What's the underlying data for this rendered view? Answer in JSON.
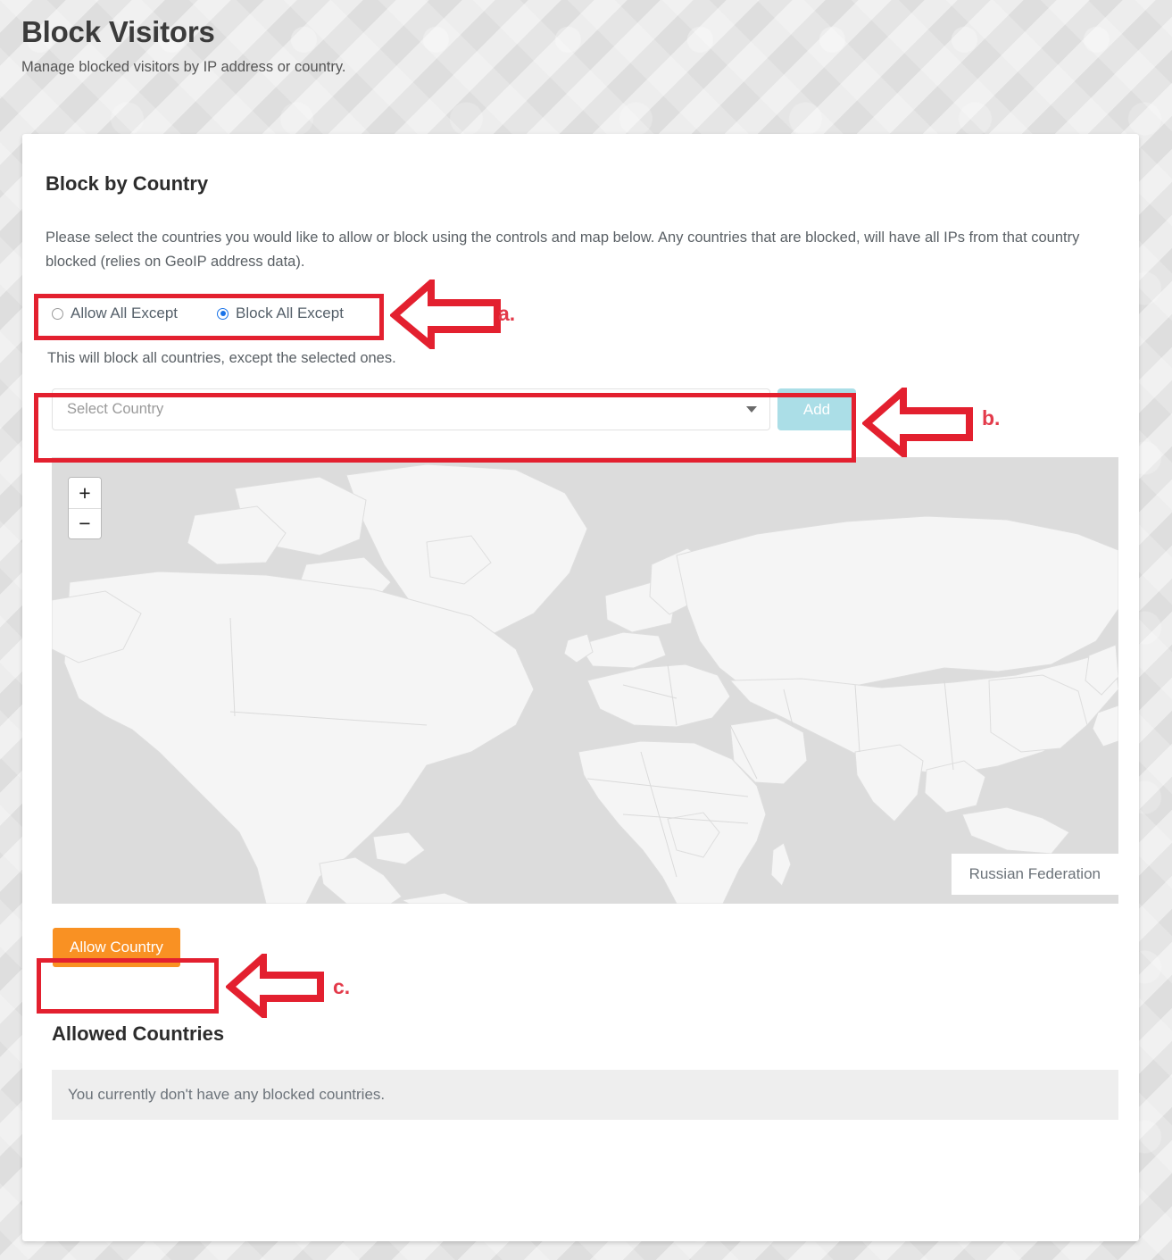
{
  "page": {
    "title": "Block Visitors",
    "subtitle": "Manage blocked visitors by IP address or country."
  },
  "card": {
    "title": "Block by Country",
    "description": "Please select the countries you would like to allow or block using the controls and map below. Any countries that are blocked, will have all IPs from that country blocked (relies on GeoIP address data).",
    "mode_hint": "This will block all countries, except the selected ones."
  },
  "mode_radios": {
    "allow_all_except": {
      "label": "Allow All Except",
      "selected": false
    },
    "block_all_except": {
      "label": "Block All Except",
      "selected": true
    }
  },
  "country_picker": {
    "placeholder": "Select Country",
    "value": "",
    "caret_icon": "chevron-down-icon",
    "add_label": "Add",
    "add_enabled": false
  },
  "map": {
    "zoom_in_label": "+",
    "zoom_out_label": "−",
    "tooltip_country": "Russian Federation",
    "ocean_color": "#dcdcdc",
    "land_color": "#f5f5f5",
    "border_color": "#dddddd"
  },
  "actions": {
    "allow_country_label": "Allow Country",
    "allow_country_color": "#f99123"
  },
  "allowed_countries": {
    "heading": "Allowed Countries",
    "empty_message": "You currently don't have any blocked countries.",
    "items": []
  },
  "annotations": {
    "color": "#e3202f",
    "markers": [
      {
        "id": "a",
        "label": "a.",
        "target": "mode-radio-group"
      },
      {
        "id": "b",
        "label": "b.",
        "target": "country-picker-row"
      },
      {
        "id": "c",
        "label": "c.",
        "target": "allow-country-button"
      }
    ]
  }
}
